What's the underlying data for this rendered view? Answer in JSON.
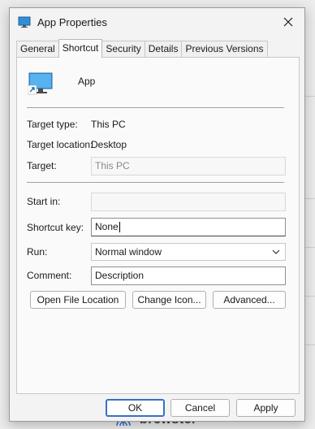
{
  "window": {
    "title": "App Properties",
    "close_icon": "close-icon"
  },
  "tabs": [
    {
      "label": "General"
    },
    {
      "label": "Shortcut"
    },
    {
      "label": "Security"
    },
    {
      "label": "Details"
    },
    {
      "label": "Previous Versions"
    }
  ],
  "active_tab": "Shortcut",
  "app": {
    "name": "App",
    "icon": "monitor-shortcut-icon"
  },
  "fields": {
    "target_type_label": "Target type:",
    "target_type_value": "This PC",
    "target_location_label": "Target location:",
    "target_location_value": "Desktop",
    "target_label": "Target:",
    "target_value": "This PC",
    "start_in_label": "Start in:",
    "start_in_value": "",
    "shortcut_key_label": "Shortcut key:",
    "shortcut_key_value": "None",
    "run_label": "Run:",
    "run_value": "Normal window",
    "comment_label": "Comment:",
    "comment_value": "Description"
  },
  "actions": {
    "open_file_location": "Open File Location",
    "change_icon": "Change Icon...",
    "advanced": "Advanced..."
  },
  "footer": {
    "ok": "OK",
    "cancel": "Cancel",
    "apply": "Apply"
  },
  "background": {
    "brand_text": "brewster"
  },
  "colors": {
    "accent": "#3b6fc4",
    "dialog_bg": "#f3f3f3",
    "panel_bg": "#fafafa"
  }
}
